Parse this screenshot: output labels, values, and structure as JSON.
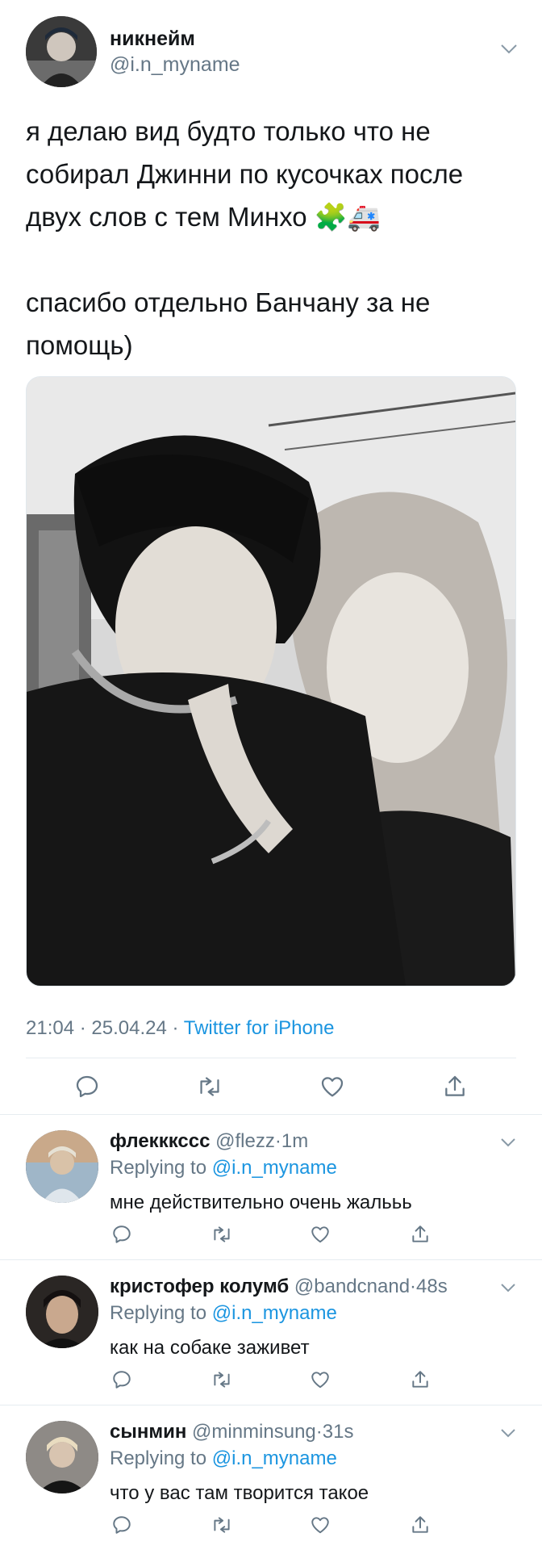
{
  "tweet": {
    "display_name": "никнейм",
    "handle": "@i.n_myname",
    "text_line1": "я делаю вид будто только что не",
    "text_line2": "собирал Джинни по кусочках после",
    "text_line3": "двух слов с тем Минхо",
    "text_emoji": "🧩🚑",
    "text_line4": "спасибо отдельно Банчану за не",
    "text_line5": "помощь)",
    "time": "21:04",
    "date": "25.04.24",
    "source": "Twitter for iPhone"
  },
  "icons": [
    "chevron-down-icon",
    "reply-icon",
    "retweet-icon",
    "like-icon",
    "share-icon"
  ],
  "replies": [
    {
      "display_name": "флекккссс",
      "handle": "@flezz",
      "time": "1m",
      "replying_label": "Replying to",
      "replying_handle": "@i.n_myname",
      "text": "мне действительно очень жалььь"
    },
    {
      "display_name": "кристофер колумб",
      "handle": "@bandcnand",
      "time": "48s",
      "replying_label": "Replying to",
      "replying_handle": "@i.n_myname",
      "text": "как на собаке заживет"
    },
    {
      "display_name": "сынмин",
      "handle": "@minminsung",
      "time": "31s",
      "replying_label": "Replying to",
      "replying_handle": "@i.n_myname",
      "text": "что у вас там творится такое"
    }
  ],
  "colors": {
    "link": "#1b95e0",
    "muted": "#657786",
    "text": "#14171a",
    "divider": "#e6ecf0"
  }
}
